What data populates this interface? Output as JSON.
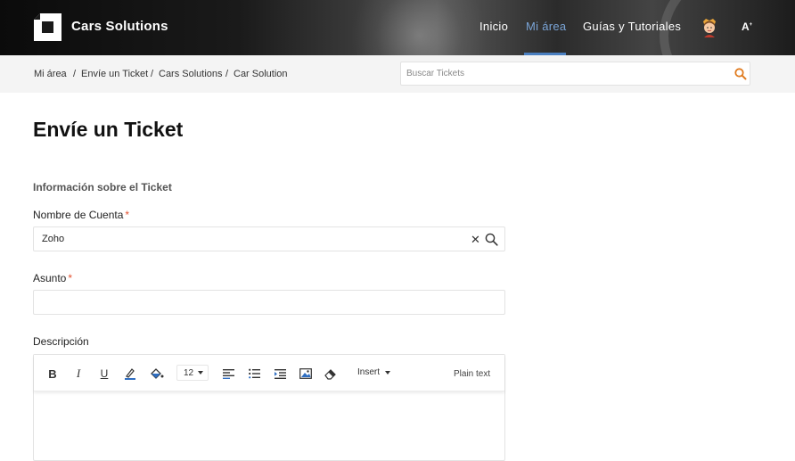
{
  "header": {
    "brand": "Cars Solutions",
    "nav": [
      {
        "label": "Inicio"
      },
      {
        "label": "Mi área"
      },
      {
        "label": "Guías y Tutoriales"
      }
    ],
    "active_color": "#7aa4d6",
    "font_size_label": "A"
  },
  "breadcrumb": {
    "items": [
      "Mi área",
      "Envíe un Ticket",
      "Cars Solutions",
      "Car Solution"
    ],
    "separator": "/"
  },
  "search": {
    "placeholder": "Buscar Tickets",
    "icon_color": "#e07b1f"
  },
  "main": {
    "title": "Envíe un Ticket",
    "section_title": "Información sobre el Ticket",
    "fields": {
      "account": {
        "label": "Nombre de Cuenta",
        "required": "*",
        "value": "Zoho"
      },
      "subject": {
        "label": "Asunto",
        "required": "*",
        "value": ""
      },
      "description": {
        "label": "Descripción"
      }
    },
    "editor": {
      "bold": "B",
      "italic": "I",
      "underline": "U",
      "font_size": "12",
      "insert": "Insert",
      "plain_text": "Plain text"
    }
  },
  "colors": {
    "required": "#e4512f",
    "accent": "#4a7fc0"
  }
}
